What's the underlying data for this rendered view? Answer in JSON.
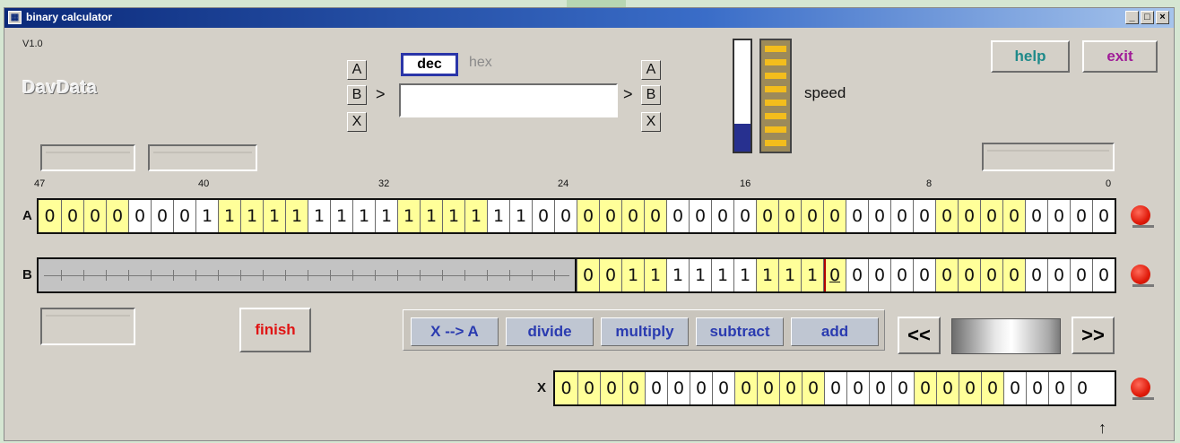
{
  "window": {
    "title": "binary calculator",
    "controls": [
      "_",
      "□",
      "×"
    ]
  },
  "app": {
    "version": "V1.0",
    "logo": "DavData"
  },
  "source_select": {
    "a": "A",
    "b": "B",
    "x": "X",
    "arrow": ">"
  },
  "dest_select": {
    "a": "A",
    "b": "B",
    "x": "X",
    "arrow": ">"
  },
  "mode_tabs": {
    "dec": "dec",
    "hex": "hex",
    "selected": "dec"
  },
  "input": {
    "value": "",
    "placeholder": ""
  },
  "speed": {
    "label": "speed",
    "level": 0.25
  },
  "buttons": {
    "help": "help",
    "exit": "exit",
    "finish": "finish",
    "x_to_a": "X --> A",
    "divide": "divide",
    "multiply": "multiply",
    "subtract": "subtract",
    "add": "add",
    "prev": "<<",
    "next": ">>"
  },
  "bit_numbers": {
    "n47": "47",
    "n40": "40",
    "n32": "32",
    "n24": "24",
    "n16": "16",
    "n8": "8",
    "n0": "0"
  },
  "rows": {
    "a": {
      "label": "A",
      "bits": [
        "0",
        "0",
        "0",
        "0",
        "0",
        "0",
        "0",
        "1",
        "1",
        "1",
        "1",
        "1",
        "1",
        "1",
        "1",
        "1",
        "1",
        "1",
        "1",
        "1",
        "1",
        "1",
        "0",
        "0",
        "0",
        "0",
        "0",
        "0",
        "0",
        "0",
        "0",
        "0",
        "0",
        "0",
        "0",
        "0",
        "0",
        "0",
        "0",
        "0",
        "0",
        "0",
        "0",
        "0",
        "0",
        "0",
        "0",
        "0"
      ]
    },
    "b": {
      "label": "B",
      "masked_bits": 24,
      "bits": [
        "0",
        "0",
        "1",
        "1",
        "1",
        "1",
        "1",
        "1",
        "1",
        "1",
        "1",
        "0",
        "0",
        "0",
        "0",
        "0",
        "0",
        "0",
        "0",
        "0",
        "0",
        "0",
        "0",
        "0"
      ],
      "cursor_index": 11
    },
    "x": {
      "label": "X",
      "bits": [
        "0",
        "0",
        "0",
        "0",
        "0",
        "0",
        "0",
        "0",
        "0",
        "0",
        "0",
        "0",
        "0",
        "0",
        "0",
        "0",
        "0",
        "0",
        "0",
        "0",
        "0",
        "0",
        "0",
        "0"
      ]
    }
  },
  "colors": {
    "bit_yellow": "#ffff99",
    "bit_white": "#ffffff",
    "titlebar": "#0b2a7a",
    "op_text": "#2a3bb0",
    "finish_text": "#e01414",
    "help_text": "#1e8a8a",
    "exit_text": "#a01c98",
    "indicator": "#e01b0b"
  },
  "icons": {
    "indicator": "red-dot-icon",
    "pointer": "arrow-up-icon"
  }
}
